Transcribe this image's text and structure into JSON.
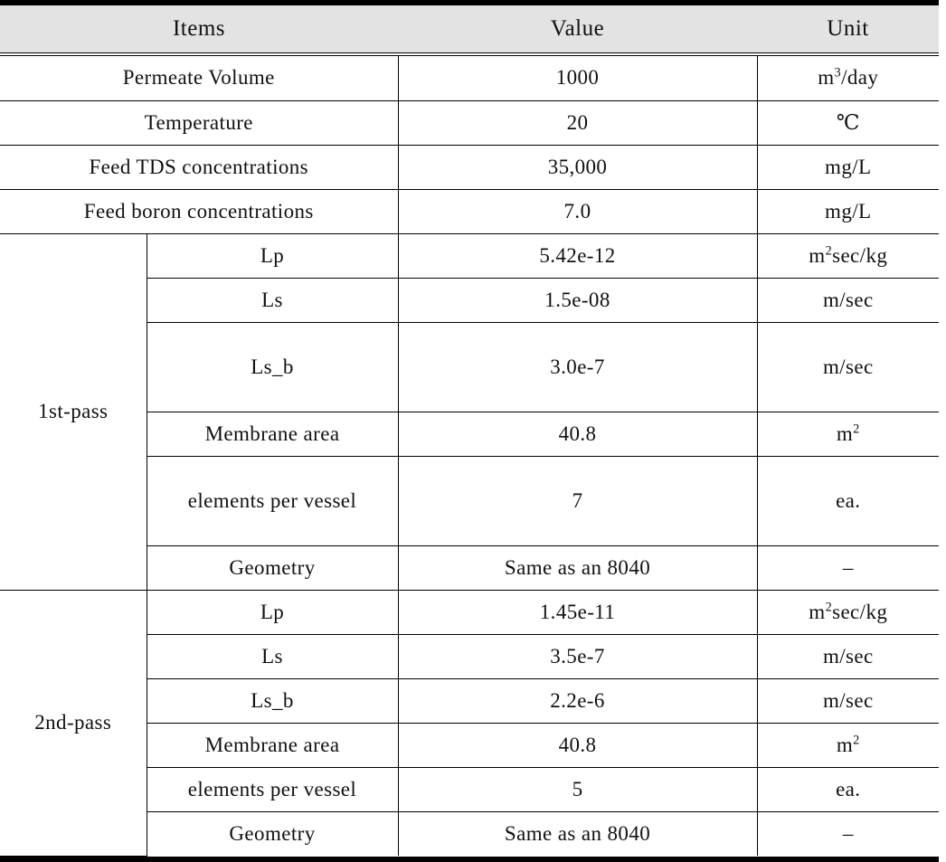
{
  "table": {
    "headers": [
      "Items",
      "Value",
      "Unit"
    ],
    "general_rows": [
      {
        "item": "Permeate  Volume",
        "value": "1000",
        "unit_base": "m",
        "unit_sup": "3",
        "unit_tail": "/day"
      },
      {
        "item": "Temperature",
        "value": "20",
        "unit_base": "℃",
        "unit_sup": "",
        "unit_tail": ""
      },
      {
        "item": "Feed  TDS  concentrations",
        "value": "35,000",
        "unit_base": "mg/L",
        "unit_sup": "",
        "unit_tail": ""
      },
      {
        "item": "Feed  boron  concentrations",
        "value": "7.0",
        "unit_base": "mg/L",
        "unit_sup": "",
        "unit_tail": ""
      }
    ],
    "passes": [
      {
        "label": "1st-pass",
        "rows": [
          {
            "item": "Lp",
            "value": "5.42e-12",
            "unit_base": "m",
            "unit_sup": "2",
            "unit_tail": "sec/kg"
          },
          {
            "item": "Ls",
            "value": "1.5e-08",
            "unit_base": "m/sec",
            "unit_sup": "",
            "unit_tail": ""
          },
          {
            "item": "Ls_b",
            "value": "3.0e-7",
            "unit_base": "m/sec",
            "unit_sup": "",
            "unit_tail": ""
          },
          {
            "item": "Membrane  area",
            "value": "40.8",
            "unit_base": "m",
            "unit_sup": "2",
            "unit_tail": ""
          },
          {
            "item": "elements  per  vessel",
            "value": "7",
            "unit_base": "ea.",
            "unit_sup": "",
            "unit_tail": ""
          },
          {
            "item": "Geometry",
            "value": "Same  as  an  8040",
            "unit_base": "–",
            "unit_sup": "",
            "unit_tail": ""
          }
        ]
      },
      {
        "label": "2nd-pass",
        "rows": [
          {
            "item": "Lp",
            "value": "1.45e-11",
            "unit_base": "m",
            "unit_sup": "2",
            "unit_tail": "sec/kg"
          },
          {
            "item": "Ls",
            "value": "3.5e-7",
            "unit_base": "m/sec",
            "unit_sup": "",
            "unit_tail": ""
          },
          {
            "item": "Ls_b",
            "value": "2.2e-6",
            "unit_base": "m/sec",
            "unit_sup": "",
            "unit_tail": ""
          },
          {
            "item": "Membrane  area",
            "value": "40.8",
            "unit_base": "m",
            "unit_sup": "2",
            "unit_tail": ""
          },
          {
            "item": "elements  per  vessel",
            "value": "5",
            "unit_base": "ea.",
            "unit_sup": "",
            "unit_tail": ""
          },
          {
            "item": "Geometry",
            "value": "Same  as  an  8040",
            "unit_base": "–",
            "unit_sup": "",
            "unit_tail": ""
          }
        ]
      }
    ],
    "colors": {
      "header_background": "#e3e3e3",
      "rule": "#000000",
      "text": "#111111",
      "page_background": "#ffffff"
    }
  }
}
